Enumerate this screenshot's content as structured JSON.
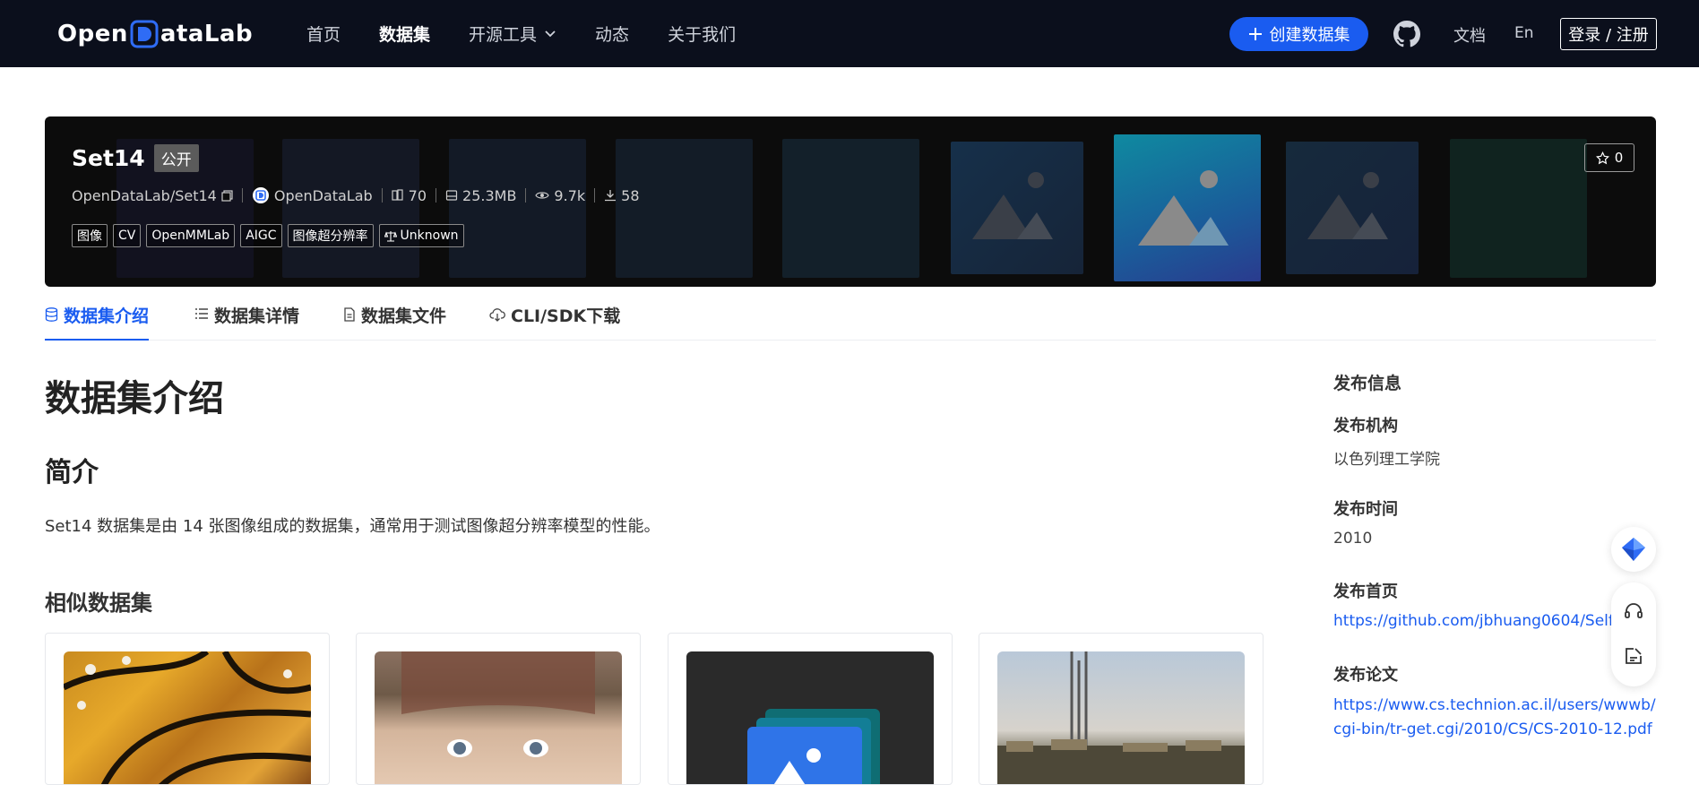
{
  "header": {
    "logo_left": "Open",
    "logo_right": "ataLab",
    "nav": [
      {
        "label": "首页",
        "active": false
      },
      {
        "label": "数据集",
        "active": true
      },
      {
        "label": "开源工具",
        "active": false
      },
      {
        "label": "动态",
        "active": false
      },
      {
        "label": "关于我们",
        "active": false
      }
    ],
    "create_label": "创建数据集",
    "docs_label": "文档",
    "lang_label": "En",
    "login_label": "登录 / 注册"
  },
  "dataset": {
    "name": "Set14",
    "visibility": "公开",
    "repo": "OpenDataLab/Set14",
    "publisher": "OpenDataLab",
    "files": "70",
    "size": "25.3MB",
    "views": "9.7k",
    "downloads": "58",
    "stars": "0",
    "tags": [
      "图像",
      "CV",
      "OpenMMLab",
      "AIGC",
      "图像超分辨率"
    ],
    "license": "Unknown"
  },
  "tabs": [
    {
      "label": "数据集介绍",
      "icon": "database-icon"
    },
    {
      "label": "数据集详情",
      "icon": "list-icon"
    },
    {
      "label": "数据集文件",
      "icon": "file-icon"
    },
    {
      "label": "CLI/SDK下载",
      "icon": "cloud-download-icon"
    }
  ],
  "main": {
    "title": "数据集介绍",
    "intro_heading": "简介",
    "intro_text": "Set14 数据集是由 14 张图像组成的数据集，通常用于测试图像超分辨率模型的性能。",
    "similar_heading": "相似数据集"
  },
  "sidebar": {
    "heading": "发布信息",
    "org_label": "发布机构",
    "org_value": "以色列理工学院",
    "time_label": "发布时间",
    "time_value": "2010",
    "home_label": "发布首页",
    "home_value": "https://github.com/jbhuang0604/SelfExS",
    "paper_label": "发布论文",
    "paper_value": "https://www.cs.technion.ac.il/users/wwwb/cgi-bin/tr-get.cgi/2010/CS/CS-2010-12.pdf"
  },
  "colors": {
    "accent": "#1a5cf0",
    "header_bg": "#0b0f1c"
  }
}
